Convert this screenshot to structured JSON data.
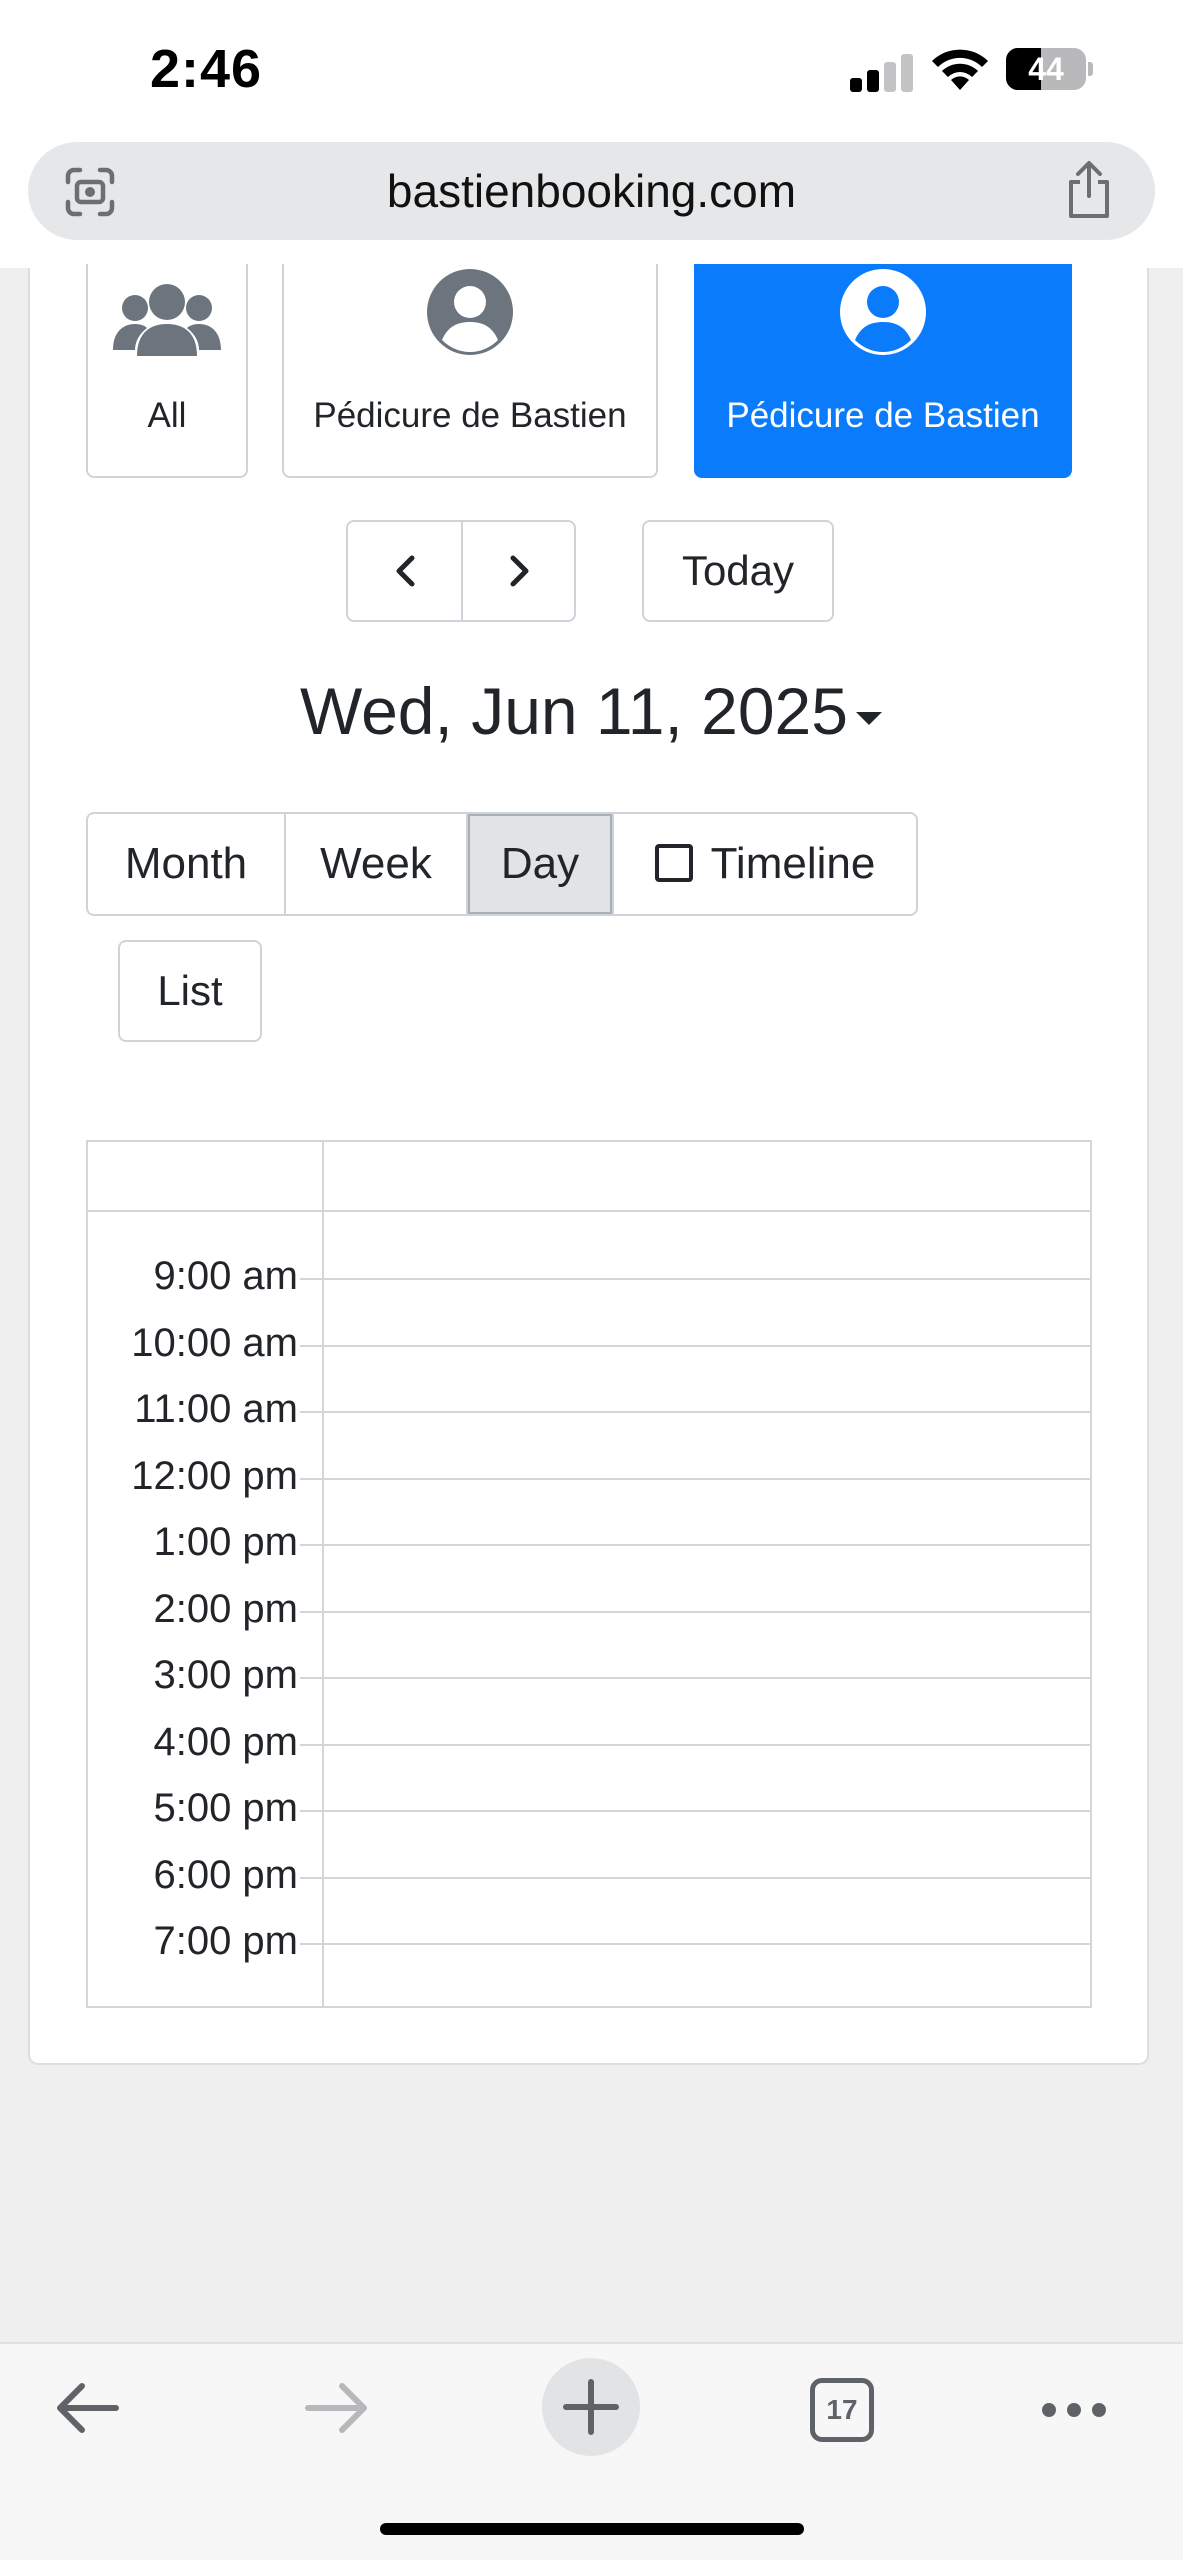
{
  "status_bar": {
    "time": "2:46",
    "battery": "44",
    "battery_level": 0.44,
    "signal_bars": 2
  },
  "browser": {
    "url": "bastienbooking.com",
    "lens_icon": "lens-icon",
    "share_icon": "share-icon"
  },
  "staff": [
    {
      "label": "All",
      "icon": "group-icon",
      "active": false
    },
    {
      "label": "Pédicure de Bastien",
      "icon": "user-circle-icon",
      "active": false
    },
    {
      "label": "Pédicure de Bastien",
      "icon": "user-circle-icon",
      "active": true
    }
  ],
  "nav": {
    "prev_icon": "chevron-left-icon",
    "next_icon": "chevron-right-icon",
    "today_label": "Today"
  },
  "date_title": "Wed, Jun 11, 2025",
  "views": {
    "month": "Month",
    "week": "Week",
    "day": "Day",
    "timeline": "Timeline",
    "list": "List",
    "active": "Day"
  },
  "time_slots": [
    "9:00 am",
    "10:00 am",
    "11:00 am",
    "12:00 pm",
    "1:00 pm",
    "2:00 pm",
    "3:00 pm",
    "4:00 pm",
    "5:00 pm",
    "6:00 pm",
    "7:00 pm"
  ],
  "toolbar": {
    "back_icon": "back-arrow-icon",
    "forward_icon": "forward-arrow-icon",
    "new_tab_icon": "plus-icon",
    "tab_count": "17",
    "more_icon": "more-icon"
  },
  "colors": {
    "accent": "#0a7cfb",
    "icon_gray": "#6c757d",
    "border": "#ced4da"
  }
}
